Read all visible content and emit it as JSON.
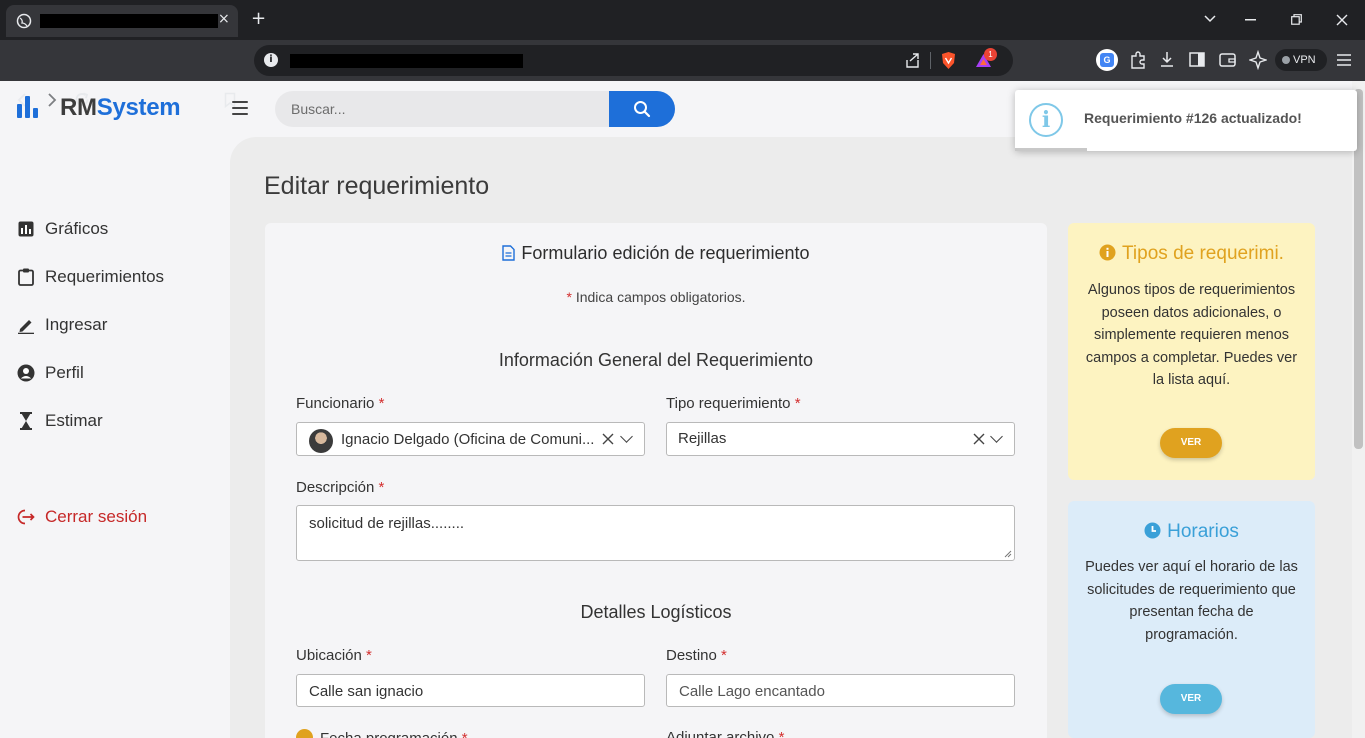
{
  "browser": {
    "tab_close": "×",
    "new_tab": "+",
    "vpn_label": "VPN",
    "brave_badge": "1"
  },
  "app": {
    "brand_prefix": "RM",
    "brand_suffix": "System",
    "accent_color": "#1e6fd9",
    "search_placeholder": "Buscar..."
  },
  "sidebar": {
    "items": [
      {
        "label": "Gráficos",
        "icon": "bar-chart-icon"
      },
      {
        "label": "Requerimientos",
        "icon": "clipboard-icon"
      },
      {
        "label": "Ingresar",
        "icon": "pencil-icon"
      },
      {
        "label": "Perfil",
        "icon": "user-circle-icon"
      },
      {
        "label": "Estimar",
        "icon": "hourglass-icon"
      }
    ],
    "logout_label": "Cerrar sesión"
  },
  "page": {
    "title": "Editar requerimiento"
  },
  "form": {
    "title": "Formulario edición de requerimiento",
    "required_star": "*",
    "required_note": "Indica campos obligatorios.",
    "section_general": "Información General del Requerimiento",
    "funcionario_label": "Funcionario",
    "funcionario_value": "Ignacio Delgado (Oficina de Comuni...",
    "tipo_label": "Tipo requerimiento",
    "tipo_value": "Rejillas",
    "descripcion_label": "Descripción",
    "descripcion_value": "solicitud de rejillas........",
    "section_logistics": "Detalles Logísticos",
    "ubicacion_label": "Ubicación",
    "ubicacion_value": "Calle san ignacio",
    "destino_label": "Destino",
    "destino_value": "Calle Lago encantado",
    "fecha_label": "Fecha programación",
    "adjuntar_label": "Adjuntar archivo"
  },
  "tipos_card": {
    "title": "Tipos de requerimi.",
    "body": "Algunos tipos de requerimientos poseen datos adicionales, o simplemente requieren menos campos a completar. Puedes ver la lista aquí.",
    "button": "VER",
    "color": "#e0a21f"
  },
  "horarios_card": {
    "title": "Horarios",
    "body": "Puedes ver aquí el horario de las solicitudes de requerimiento que presentan fecha de programación.",
    "button": "VER",
    "color": "#3aa0d8"
  },
  "toast": {
    "message": "Requerimiento #126 actualizado!",
    "progress": 0.21
  }
}
